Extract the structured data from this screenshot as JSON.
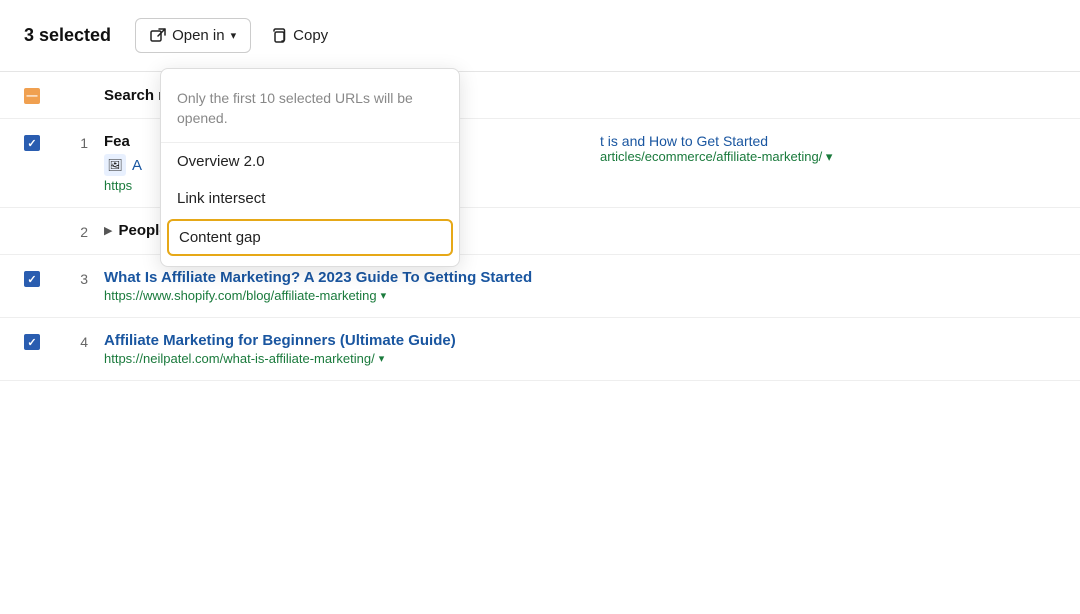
{
  "toolbar": {
    "selected_label": "3 selected",
    "open_in_label": "Open in",
    "copy_label": "Copy"
  },
  "dropdown": {
    "note": "Only the first 10 selected URLs will be opened.",
    "items": [
      {
        "id": "overview",
        "label": "Overview 2.0",
        "highlighted": false
      },
      {
        "id": "link-intersect",
        "label": "Link intersect",
        "highlighted": false
      },
      {
        "id": "content-gap",
        "label": "Content gap",
        "highlighted": true
      }
    ]
  },
  "rows": [
    {
      "type": "header",
      "checkbox": "minus",
      "label": "Search re"
    },
    {
      "type": "data",
      "number": "1",
      "checkbox": "checked",
      "title_left_partial": "Fea",
      "image_icon": "🖼",
      "link_partial": "A",
      "url_partial": "https",
      "right_link": "t is and How to Get Started",
      "right_url": "articles/ecommerce/affiliate-marketing/"
    },
    {
      "type": "expandable",
      "number": "2",
      "title": "People also ask",
      "expanded": false
    },
    {
      "type": "data-full",
      "number": "3",
      "checkbox": "checked",
      "title": "What Is Affiliate Marketing? A 2023 Guide To Getting Started",
      "url": "https://www.shopify.com/blog/affiliate-marketing"
    },
    {
      "type": "data-full",
      "number": "4",
      "checkbox": "checked",
      "title": "Affiliate Marketing for Beginners (Ultimate Guide)",
      "url": "https://neilpatel.com/what-is-affiliate-marketing/"
    }
  ]
}
